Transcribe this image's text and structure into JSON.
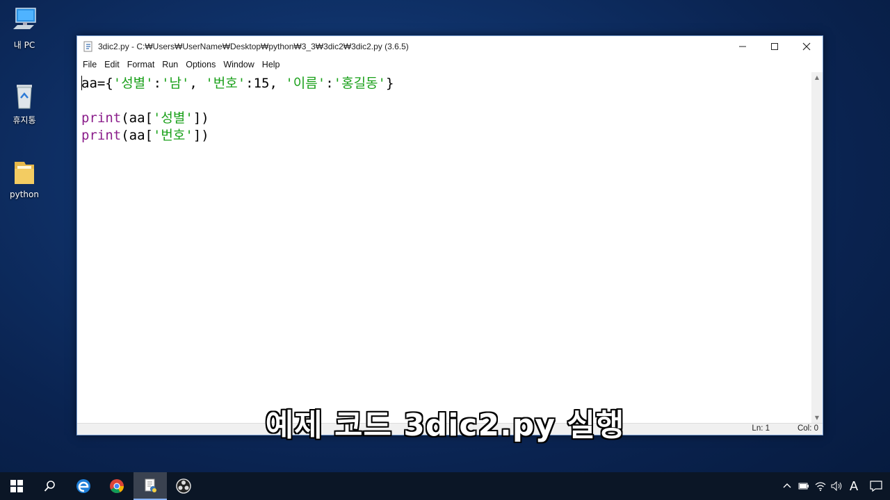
{
  "desktop": {
    "icons": [
      {
        "label": "내 PC",
        "icon": "computer-icon"
      },
      {
        "label": "휴지통",
        "icon": "recycle-bin-icon"
      },
      {
        "label": "python",
        "icon": "folder-icon"
      }
    ]
  },
  "window": {
    "title": "3dic2.py - C:₩Users₩UserName₩Desktop₩python₩3_3₩3dic2₩3dic2.py (3.6.5)",
    "controls": {
      "minimize": "—",
      "maximize": "☐",
      "close": "✕"
    },
    "menu": [
      "File",
      "Edit",
      "Format",
      "Run",
      "Options",
      "Window",
      "Help"
    ],
    "code": {
      "line1": {
        "p1": "aa={",
        "s1": "'성별'",
        "p2": ":",
        "s2": "'남'",
        "p3": ", ",
        "s3": "'번호'",
        "p4": ":15, ",
        "s4": "'이름'",
        "p5": ":",
        "s5": "'홍길동'",
        "p6": "}"
      },
      "line3": {
        "kw": "print",
        "p1": "(aa[",
        "s1": "'성별'",
        "p2": "])"
      },
      "line4": {
        "kw": "print",
        "p1": "(aa[",
        "s1": "'번호'",
        "p2": "])"
      }
    },
    "status": {
      "ln": "Ln: 1",
      "col": "Col: 0"
    }
  },
  "subtitle": "예제 코드 3dic2.py 실행",
  "taskbar": {
    "items": [
      "windows-start-icon",
      "search-icon",
      "edge-icon",
      "chrome-icon",
      "python-idle-icon",
      "obs-icon"
    ],
    "tray": [
      "chevron-up-icon",
      "battery-icon",
      "wifi-icon",
      "volume-icon",
      "ime-icon",
      "notification-icon"
    ],
    "ime_label": "A"
  },
  "colors": {
    "keyword": "#8b1e8b",
    "string": "#19a019",
    "taskbar": "#0b1626"
  }
}
